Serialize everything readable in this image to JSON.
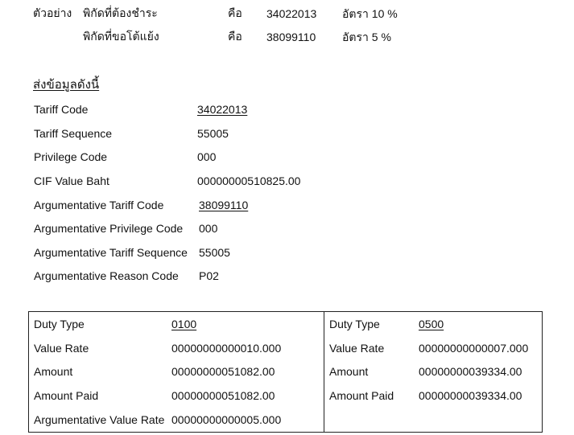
{
  "example": {
    "label": "ตัวอย่าง",
    "rows": [
      {
        "desc": "พิกัดที่ต้องชำระ",
        "is_word": "คือ",
        "code": "34022013",
        "rate_prefix": "อัตรา",
        "rate_value": "10 %"
      },
      {
        "desc": "พิกัดที่ขอโต้แย้ง",
        "is_word": "คือ",
        "code": "38099110",
        "rate_prefix": "อัตรา",
        "rate_value": "5 %"
      }
    ]
  },
  "send_data": {
    "title": "ส่งข้อมูลดังนี้",
    "fields": [
      {
        "label": "Tariff Code",
        "value": "34022013",
        "underline": true
      },
      {
        "label": "Tariff Sequence",
        "value": "55005",
        "underline": false
      },
      {
        "label": "Privilege Code",
        "value": "000",
        "underline": false
      },
      {
        "label": "CIF Value Baht",
        "value": "00000000510825.00",
        "underline": false
      },
      {
        "label": "Argumentative Tariff Code",
        "value": "38099110",
        "underline": true
      },
      {
        "label": "Argumentative Privilege Code",
        "value": "000",
        "underline": false
      },
      {
        "label": "Argumentative Tariff Sequence",
        "value": "55005",
        "underline": false
      },
      {
        "label": "Argumentative Reason Code",
        "value": "P02",
        "underline": false
      }
    ]
  },
  "duty": {
    "left": [
      {
        "label": "Duty Type",
        "value": "0100",
        "underline": true
      },
      {
        "label": "Value Rate",
        "value": "00000000000010.000",
        "underline": false
      },
      {
        "label": "Amount",
        "value": "00000000051082.00",
        "underline": false
      },
      {
        "label": "Amount Paid",
        "value": "00000000051082.00",
        "underline": false
      },
      {
        "label": "Argumentative Value Rate",
        "value": "00000000000005.000",
        "underline": false
      }
    ],
    "right": [
      {
        "label": "Duty Type",
        "value": "0500",
        "underline": true
      },
      {
        "label": "Value Rate",
        "value": "00000000000007.000",
        "underline": false
      },
      {
        "label": "Amount",
        "value": "00000000039334.00",
        "underline": false
      },
      {
        "label": "Amount Paid",
        "value": "00000000039334.00",
        "underline": false
      }
    ]
  }
}
